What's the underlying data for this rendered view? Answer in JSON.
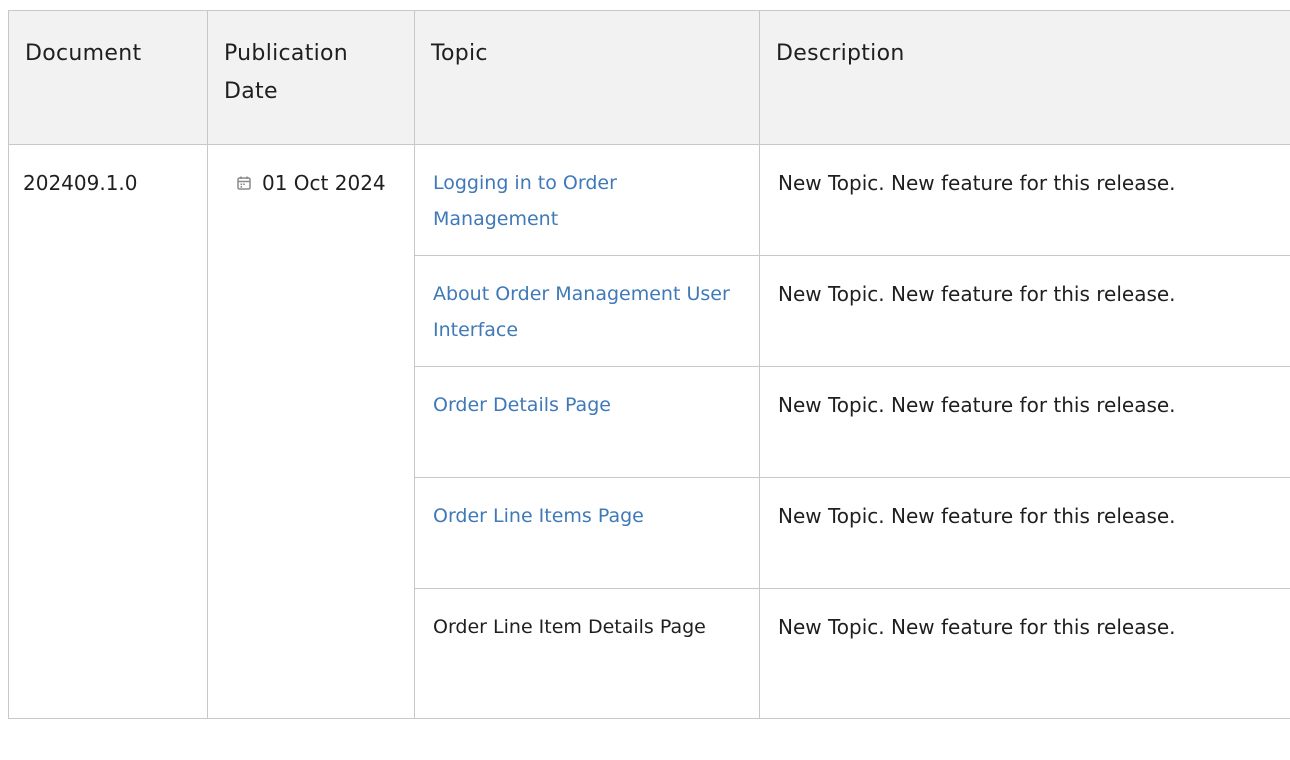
{
  "table": {
    "headers": [
      "Document",
      "Publication Date",
      "Topic",
      "Description"
    ],
    "document": "202409.1.0",
    "publication_date": "01 Oct 2024",
    "date_icon": "calendar-icon",
    "rows": [
      {
        "topic": "Logging in to Order Management",
        "linked": true,
        "description": "New Topic. New feature for this release."
      },
      {
        "topic": "About Order Management User Interface",
        "linked": true,
        "description": "New Topic. New feature for this release."
      },
      {
        "topic": "Order Details Page",
        "linked": true,
        "description": "New Topic. New feature for this release."
      },
      {
        "topic": "Order Line Items Page",
        "linked": true,
        "description": "New Topic. New feature for this release."
      },
      {
        "topic": "Order Line Item Details Page",
        "linked": false,
        "description": "New Topic. New feature for this release."
      }
    ],
    "colors": {
      "link": "#3f79b8",
      "header_bg": "#f2f2f2",
      "border": "#c8c8c8"
    }
  }
}
